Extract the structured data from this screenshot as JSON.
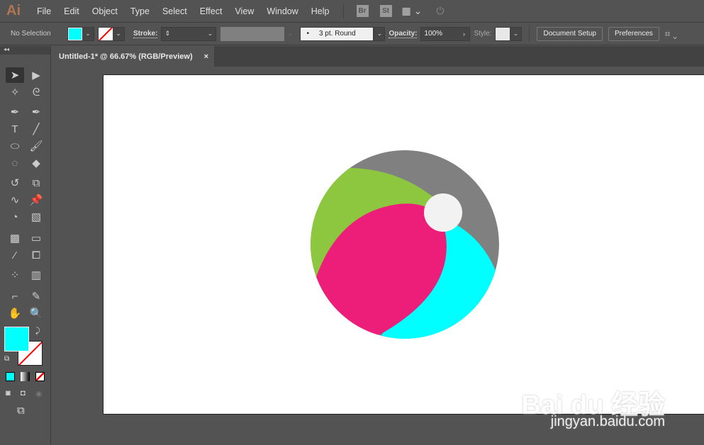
{
  "app": {
    "logo": "Ai"
  },
  "menu": [
    "File",
    "Edit",
    "Object",
    "Type",
    "Select",
    "Effect",
    "View",
    "Window",
    "Help"
  ],
  "app_bar": {
    "bridge": "Br",
    "stock": "St"
  },
  "control": {
    "selection": "No Selection",
    "fill_color": "#00ffff",
    "stroke_label": "Stroke:",
    "brush": "3 pt. Round",
    "opacity_label": "Opacity:",
    "opacity": "100%",
    "style_label": "Style:",
    "document_setup": "Document Setup",
    "preferences": "Preferences"
  },
  "document_tab": {
    "title": "Untitled-1* @ 66.67% (RGB/Preview)",
    "close": "×"
  },
  "artwork": {
    "colors": {
      "base": "#808080",
      "green": "#8dc63f",
      "pink": "#ed1e79",
      "cyan": "#00ffff",
      "highlight": "#f2f2f2"
    }
  },
  "watermark": {
    "brand": "Bai du 经验",
    "url": "jingyan.baidu.com"
  }
}
